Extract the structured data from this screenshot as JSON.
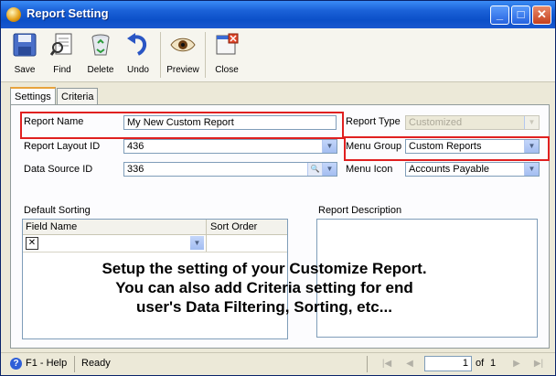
{
  "window": {
    "title": "Report Setting"
  },
  "toolbar": {
    "buttons": [
      {
        "label": "Save"
      },
      {
        "label": "Find"
      },
      {
        "label": "Delete"
      },
      {
        "label": "Undo"
      },
      {
        "label": "Preview"
      },
      {
        "label": "Close"
      }
    ]
  },
  "tabs": [
    "Settings",
    "Criteria"
  ],
  "form": {
    "report_name_label": "Report Name",
    "report_name_value": "My New Custom Report",
    "report_layout_label": "Report Layout ID",
    "report_layout_value": "436",
    "data_source_label": "Data Source ID",
    "data_source_value": "336",
    "report_type_label": "Report Type",
    "report_type_value": "Customized",
    "menu_group_label": "Menu Group",
    "menu_group_value": "Custom Reports",
    "menu_icon_label": "Menu Icon",
    "menu_icon_value": "Accounts Payable"
  },
  "sorting": {
    "title": "Default Sorting",
    "columns": [
      "Field Name",
      "Sort Order"
    ]
  },
  "description": {
    "title": "Report Description"
  },
  "overlay": {
    "line1": "Setup the setting of your Customize Report.",
    "line2": "You can also add Criteria setting for end",
    "line3": "user's Data Filtering, Sorting, etc..."
  },
  "status": {
    "help": "F1 - Help",
    "state": "Ready",
    "page": "1",
    "of_label": "of",
    "total": "1"
  },
  "colors": {
    "highlight": "#e02020",
    "titlebar": "#0b4fc8"
  }
}
